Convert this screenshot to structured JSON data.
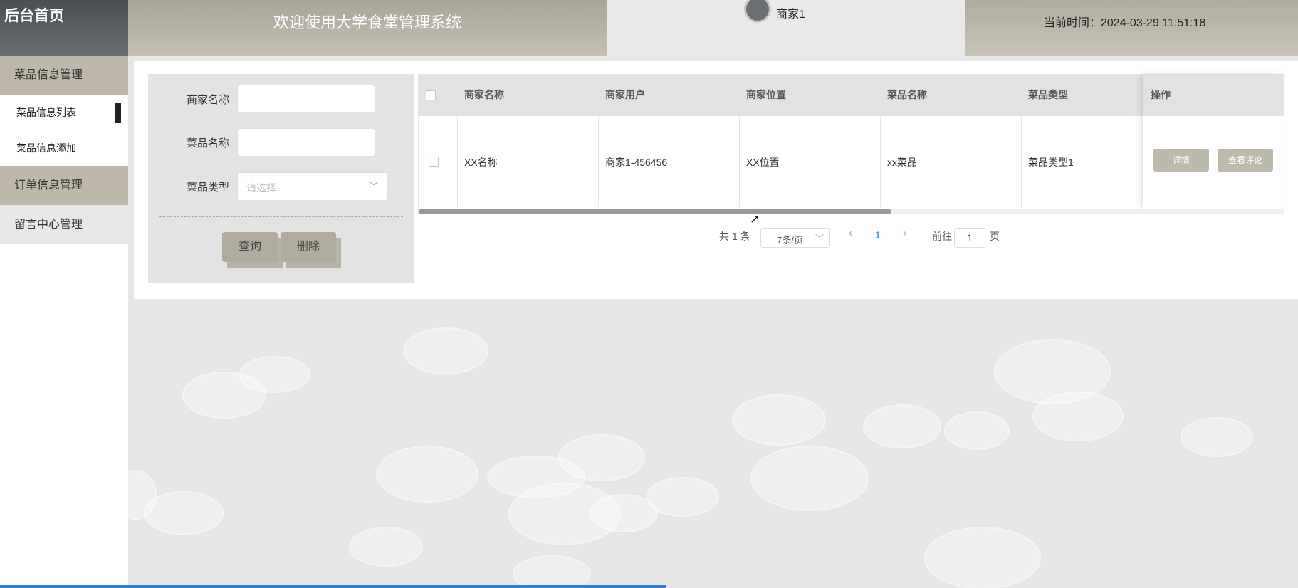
{
  "header": {
    "logo": "后台首页",
    "welcome": "欢迎使用大学食堂管理系统",
    "username": "商家1",
    "current_time": "当前时间：2024-03-29 11:51:18"
  },
  "sidebar": {
    "groups": [
      {
        "label": "菜品信息管理",
        "items": [
          {
            "label": "菜品信息列表",
            "active": true
          },
          {
            "label": "菜品信息添加"
          }
        ]
      },
      {
        "label": "订单信息管理"
      },
      {
        "label": "留言中心管理"
      }
    ]
  },
  "search": {
    "merchant_name_label": "商家名称",
    "merchant_name_value": "",
    "dish_name_label": "菜品名称",
    "dish_name_value": "",
    "dish_type_label": "菜品类型",
    "dish_type_placeholder": "请选择",
    "query_button": "查询",
    "delete_button": "删除"
  },
  "table": {
    "columns": [
      "商家名称",
      "商家用户",
      "商家位置",
      "菜品名称",
      "菜品类型",
      "操作"
    ],
    "rows": [
      {
        "merchant_name": "XX名称",
        "merchant_user": "商家1-456456",
        "merchant_location": "XX位置",
        "dish_name": "xx菜品",
        "dish_type": "菜品类型1",
        "actions": [
          "详情",
          "查看评论"
        ]
      }
    ]
  },
  "pagination": {
    "total": "共 1 条",
    "page_size": "7条/页",
    "current_page": "1",
    "goto_label": "前往",
    "goto_value": "1",
    "page_suffix": "页"
  },
  "colors": {
    "accent": "#bdb8a9",
    "active_page": "#409eff"
  }
}
